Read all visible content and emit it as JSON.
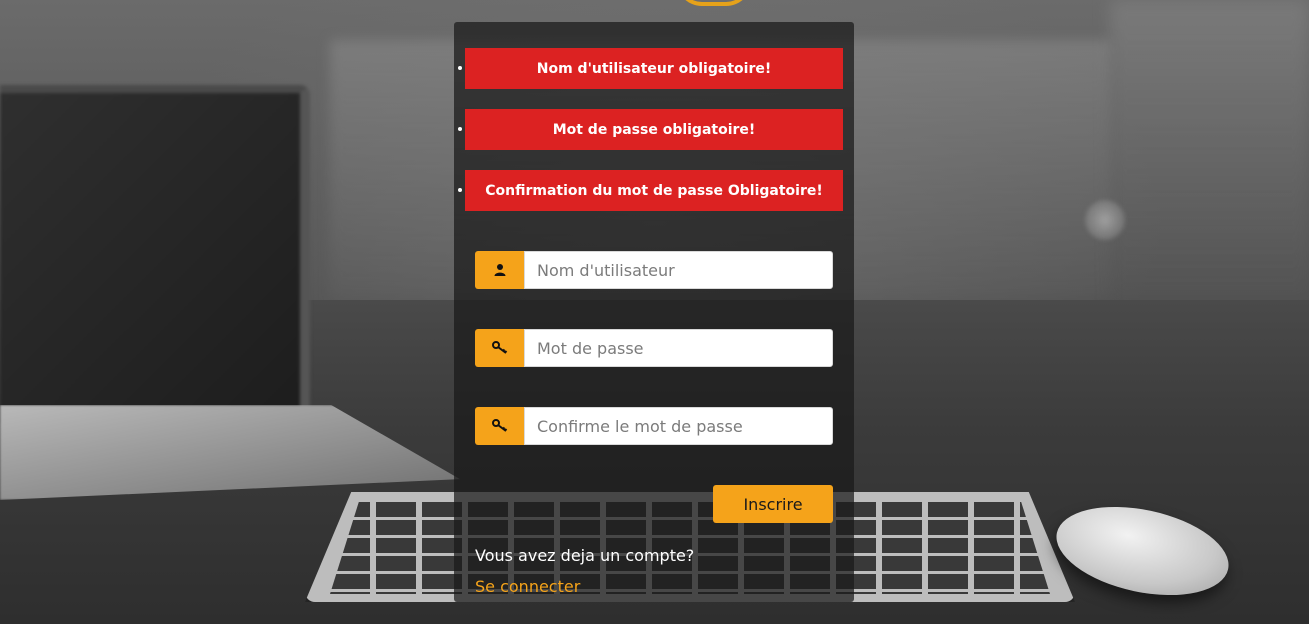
{
  "errors": [
    "Nom d'utilisateur obligatoire!",
    "Mot de passe obligatoire!",
    "Confirmation du mot de passe Obligatoire!"
  ],
  "form": {
    "username_placeholder": "Nom d'utilisateur",
    "password_placeholder": "Mot de passe",
    "confirm_placeholder": "Confirme le mot de passe",
    "submit_label": "Inscrire"
  },
  "footer": {
    "have_account_text": "Vous avez deja un compte?",
    "login_link_label": "Se connecter"
  },
  "icons": {
    "username": "user-icon",
    "password": "key-icon",
    "confirm": "key-icon"
  },
  "colors": {
    "accent": "#f5a31a",
    "error": "#dc2222",
    "panel": "#191919"
  }
}
